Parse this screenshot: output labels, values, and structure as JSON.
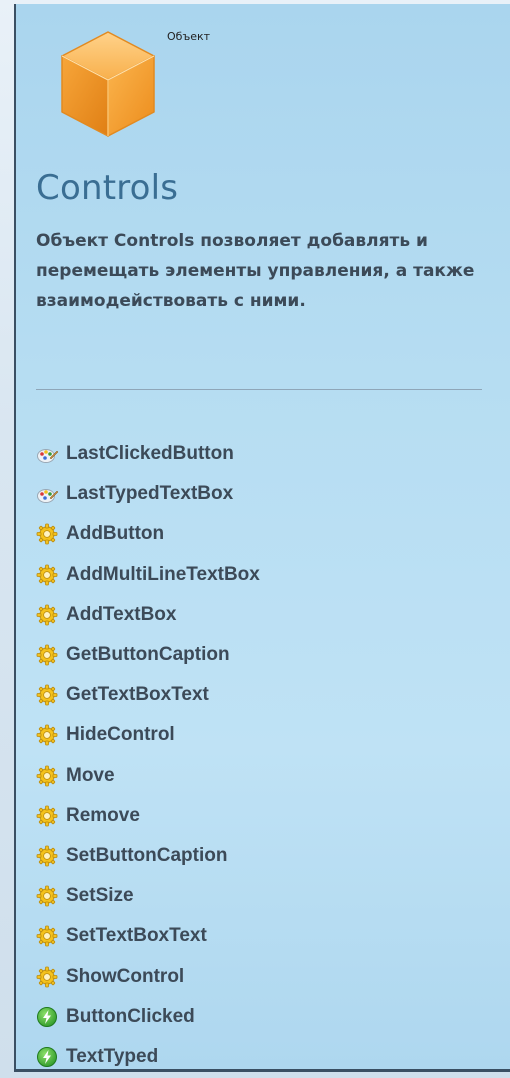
{
  "header": {
    "object_label": "Объект",
    "title": "Controls",
    "description": "Объект Controls позволяет добавлять и перемещать элементы управления, а также взаимодействовать с ними."
  },
  "members": [
    {
      "name": "LastClickedButton",
      "icon": "property-icon"
    },
    {
      "name": "LastTypedTextBox",
      "icon": "property-icon"
    },
    {
      "name": "AddButton",
      "icon": "method-icon"
    },
    {
      "name": "AddMultiLineTextBox",
      "icon": "method-icon"
    },
    {
      "name": "AddTextBox",
      "icon": "method-icon"
    },
    {
      "name": "GetButtonCaption",
      "icon": "method-icon"
    },
    {
      "name": "GetTextBoxText",
      "icon": "method-icon"
    },
    {
      "name": "HideControl",
      "icon": "method-icon"
    },
    {
      "name": "Move",
      "icon": "method-icon"
    },
    {
      "name": "Remove",
      "icon": "method-icon"
    },
    {
      "name": "SetButtonCaption",
      "icon": "method-icon"
    },
    {
      "name": "SetSize",
      "icon": "method-icon"
    },
    {
      "name": "SetTextBoxText",
      "icon": "method-icon"
    },
    {
      "name": "ShowControl",
      "icon": "method-icon"
    },
    {
      "name": "ButtonClicked",
      "icon": "event-icon"
    },
    {
      "name": "TextTyped",
      "icon": "event-icon"
    }
  ],
  "colors": {
    "panel_bg": "#b6ddf2",
    "title": "#3a6e93",
    "text": "#3c4a58",
    "cube": "#f5a23a"
  }
}
